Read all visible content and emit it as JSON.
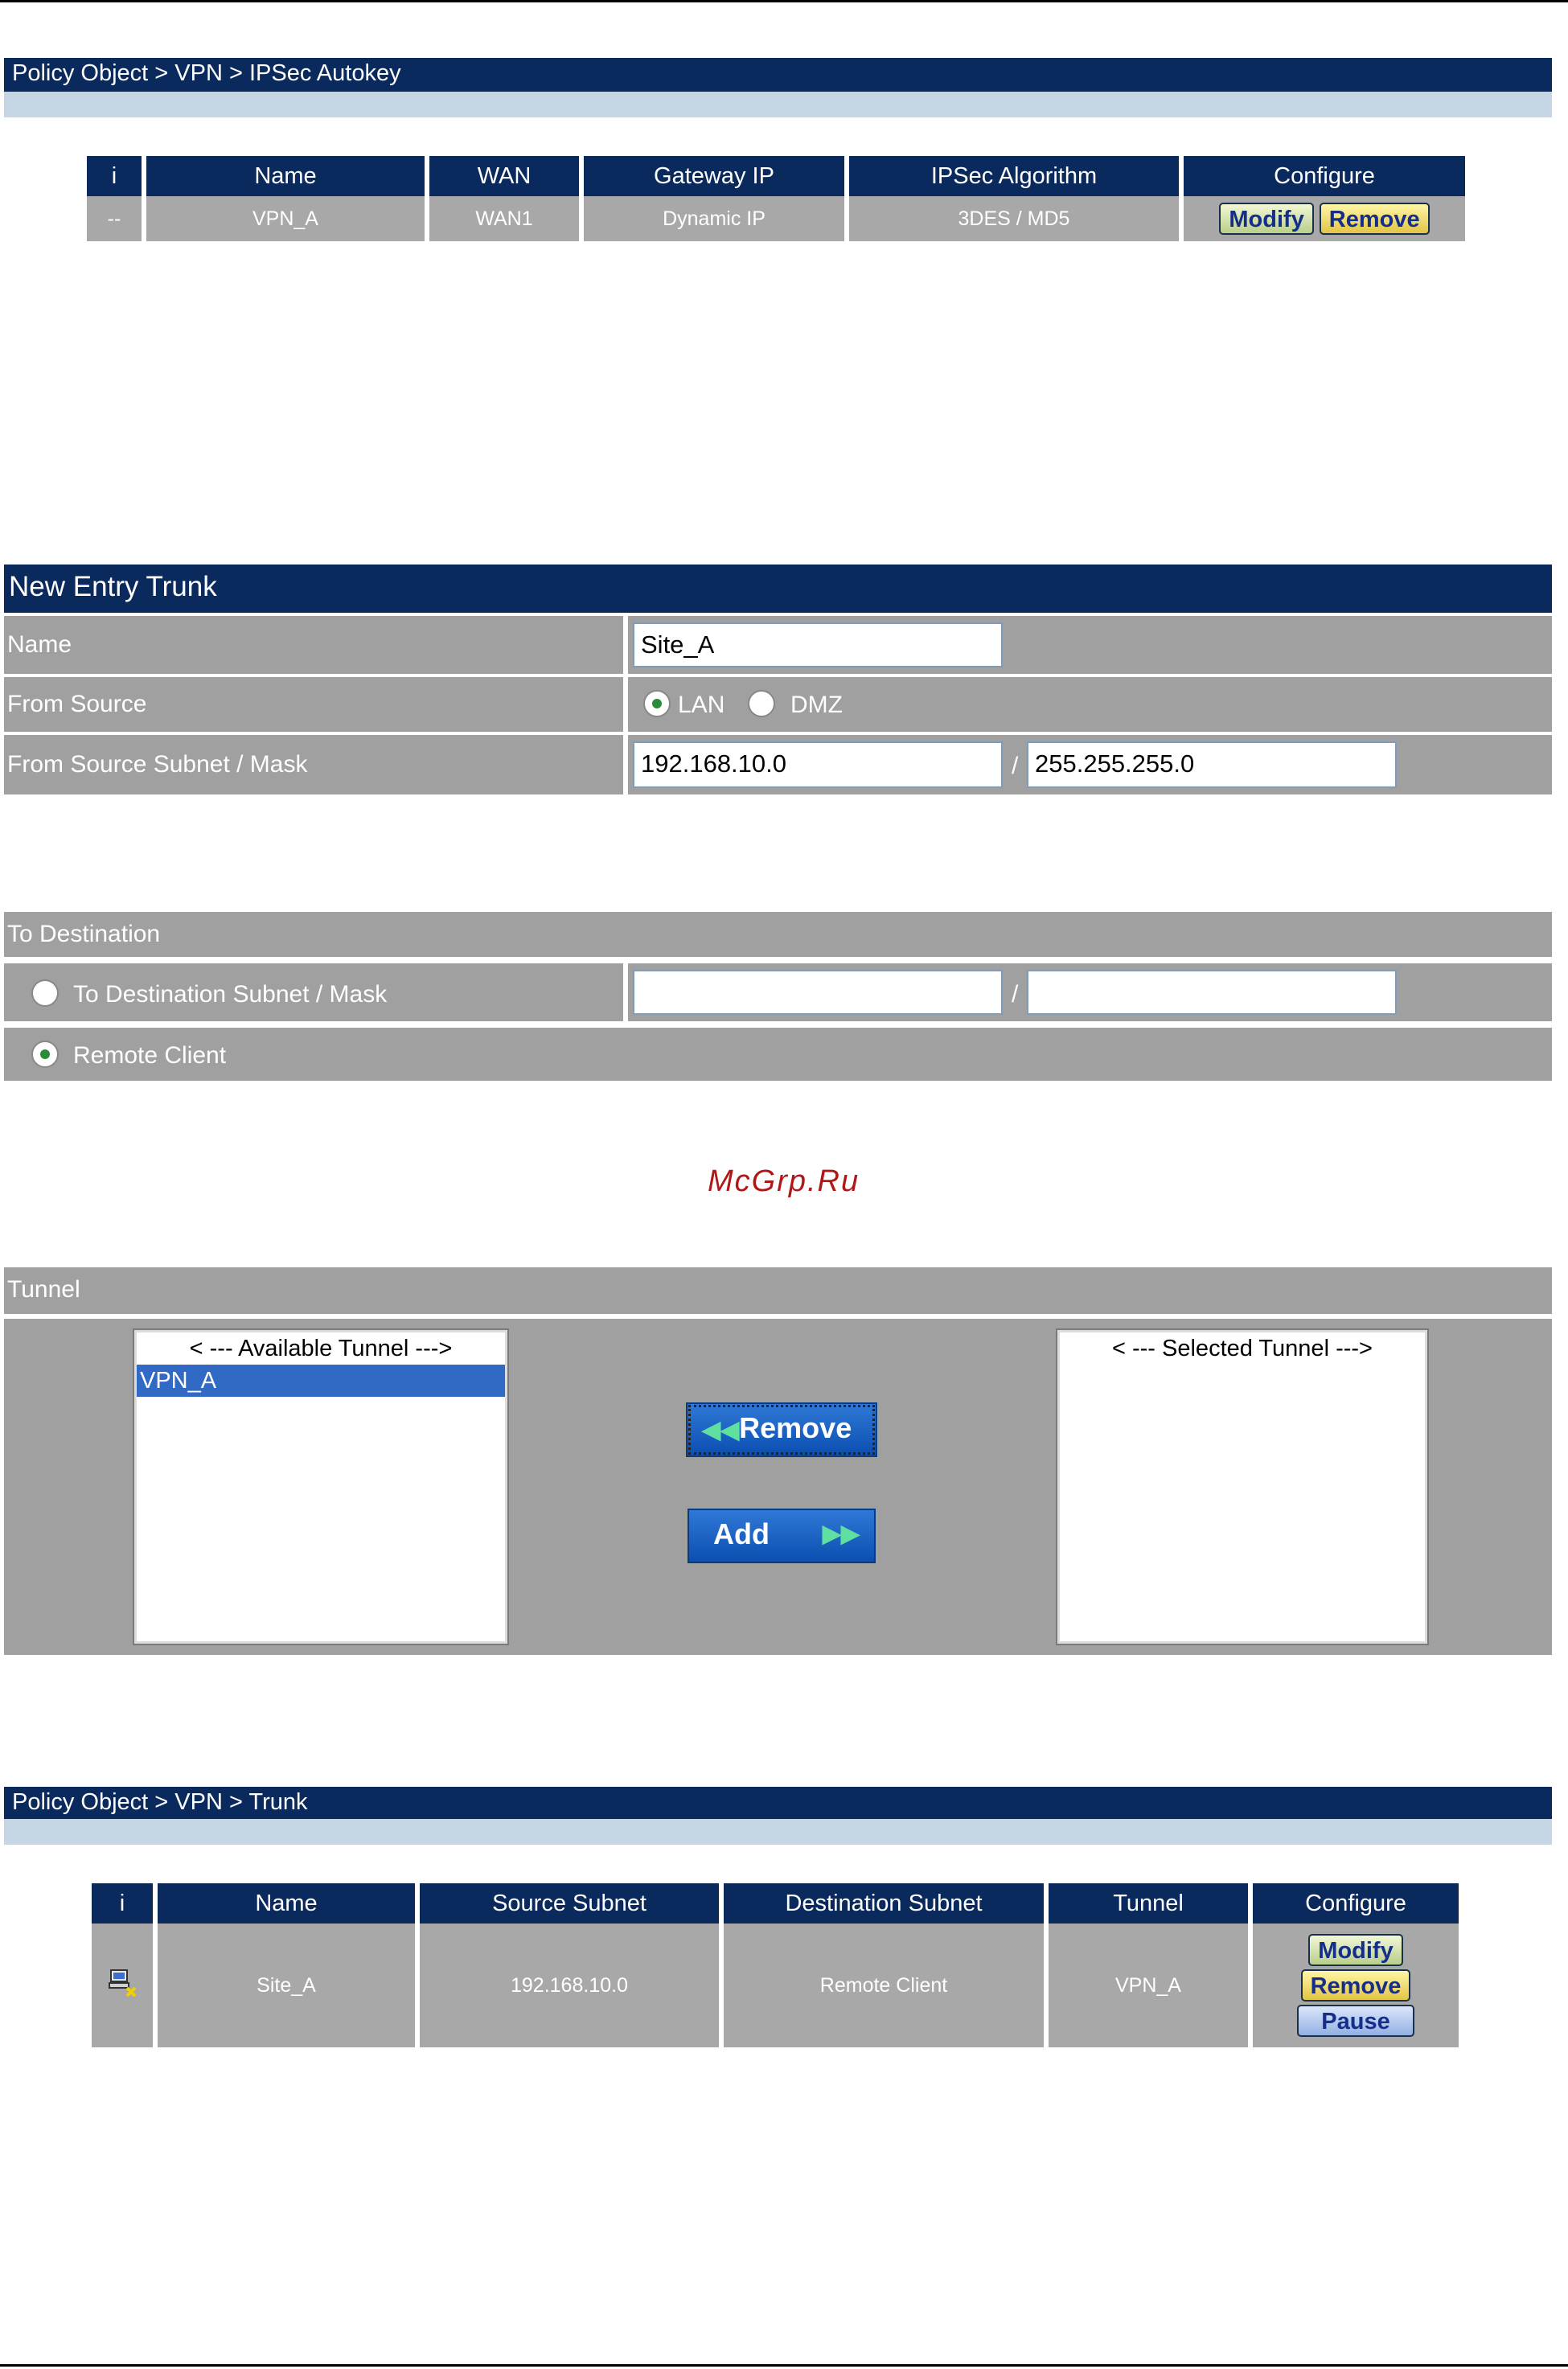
{
  "autokey": {
    "breadcrumb": "Policy Object > VPN > IPSec Autokey",
    "columns": [
      "i",
      "Name",
      "WAN",
      "Gateway IP",
      "IPSec Algorithm",
      "Configure"
    ],
    "row": {
      "i": "--",
      "name": "VPN_A",
      "wan": "WAN1",
      "gateway_ip": "Dynamic IP",
      "algorithm": "3DES / MD5"
    },
    "modify_label": "Modify",
    "remove_label": "Remove"
  },
  "new_entry": {
    "title": "New Entry Trunk",
    "name_label": "Name",
    "name_value": "Site_A",
    "from_source_label": "From Source",
    "source_options": [
      "LAN",
      "DMZ"
    ],
    "source_selected": "LAN",
    "subnet_label": "From Source Subnet / Mask",
    "subnet_value": "192.168.10.0",
    "mask_value": "255.255.255.0",
    "slash": "/"
  },
  "destination": {
    "title": "To Destination",
    "subnet_option_label": "To Destination Subnet / Mask",
    "subnet_value": "",
    "mask_value": "",
    "remote_client_label": "Remote Client",
    "selected": "Remote Client"
  },
  "watermark": "McGrp.Ru",
  "tunnel": {
    "title": "Tunnel",
    "available_header": "< --- Available Tunnel --->",
    "available_items": [
      "VPN_A"
    ],
    "selected_header": "< --- Selected Tunnel --->",
    "remove_label": "Remove",
    "add_label": "Add",
    "remove_arrow": "◀◀",
    "add_arrow": "▶▶"
  },
  "trunk": {
    "breadcrumb": "Policy Object > VPN > Trunk",
    "columns": [
      "i",
      "Name",
      "Source Subnet",
      "Destination Subnet",
      "Tunnel",
      "Configure"
    ],
    "row": {
      "icon": "network-computer-icon",
      "name": "Site_A",
      "source_subnet": "192.168.10.0",
      "destination_subnet": "Remote Client",
      "tunnel": "VPN_A"
    },
    "modify_label": "Modify",
    "remove_label": "Remove",
    "pause_label": "Pause"
  },
  "colors": {
    "navy": "#0a2a5e",
    "gray_row": "#a0a0a0",
    "light_strip": "#c5d5e3",
    "selection_blue": "#316ac5",
    "button_blue": "#0b4fb0"
  }
}
